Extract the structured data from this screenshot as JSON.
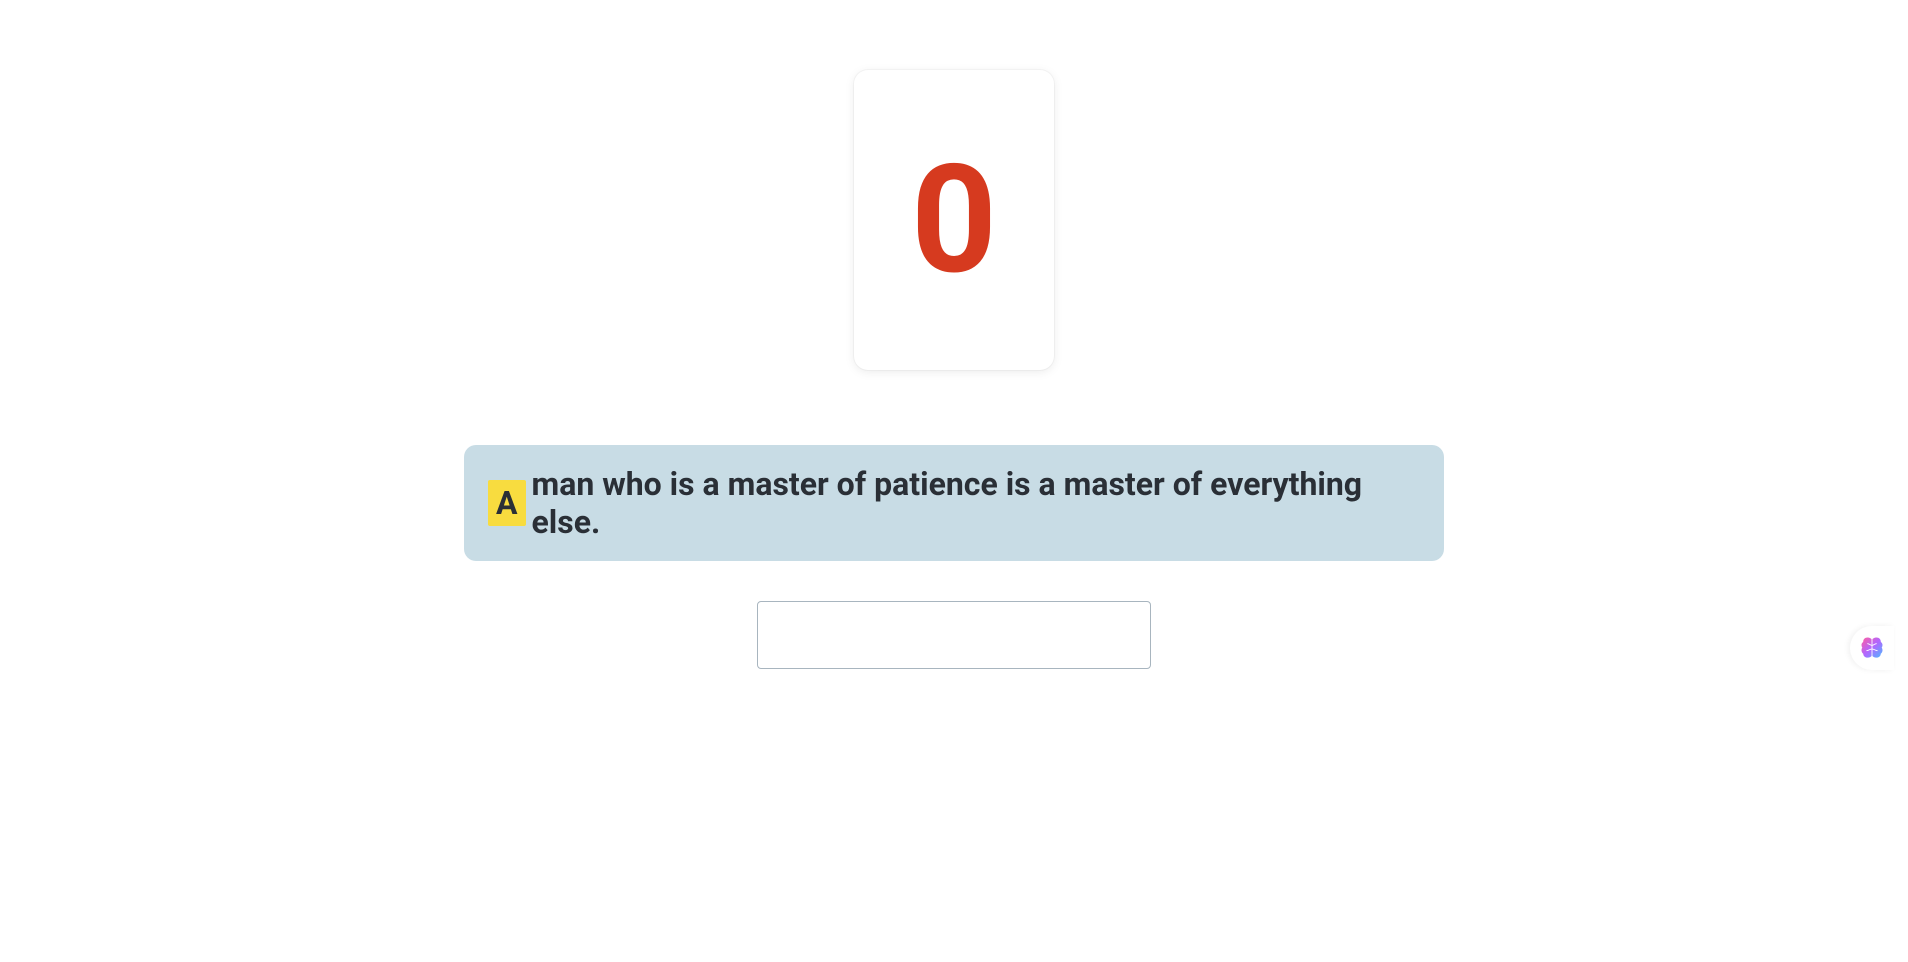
{
  "counter": {
    "value": "0"
  },
  "quote": {
    "highlighted_char": "A",
    "rest": " man who is a master of patience is a master of everything else."
  },
  "typing_input": {
    "value": "",
    "placeholder": ""
  },
  "colors": {
    "counter_color": "#d63a1f",
    "quote_bg": "#c8dce5",
    "highlight_bg": "#f8dc3f",
    "text_color": "#2a2f36"
  }
}
